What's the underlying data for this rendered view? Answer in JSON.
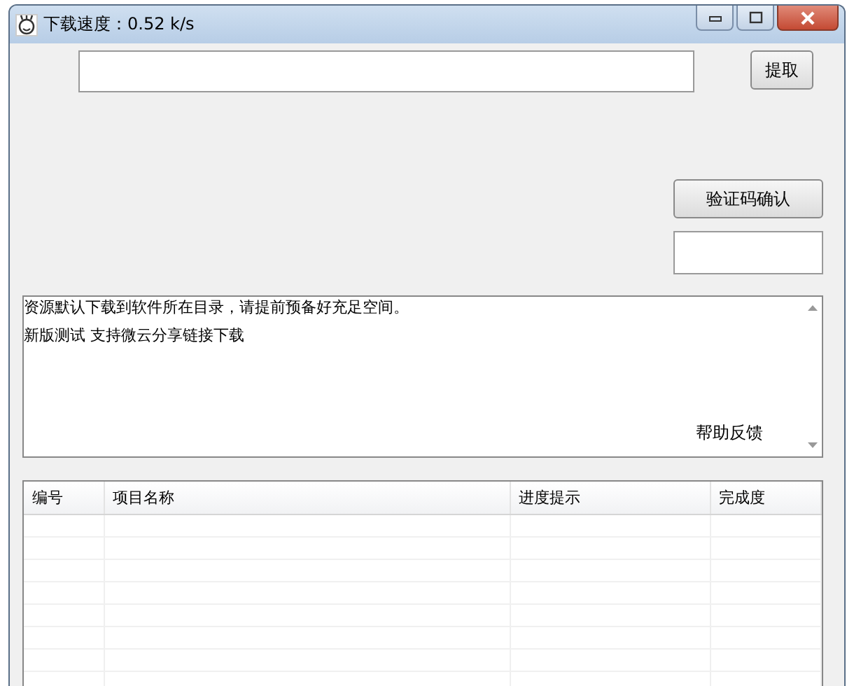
{
  "window": {
    "title": "下载速度：0.52 k/s"
  },
  "extract_button": "提取",
  "verify_button": "验证码确认",
  "log": {
    "lines": [
      "资源默认下载到软件所在目录，请提前预备好充足空间。",
      "新版测试 支持微云分享链接下载"
    ],
    "help_link": "帮助反馈"
  },
  "table": {
    "columns": [
      "编号",
      "项目名称",
      "进度提示",
      "完成度"
    ]
  }
}
